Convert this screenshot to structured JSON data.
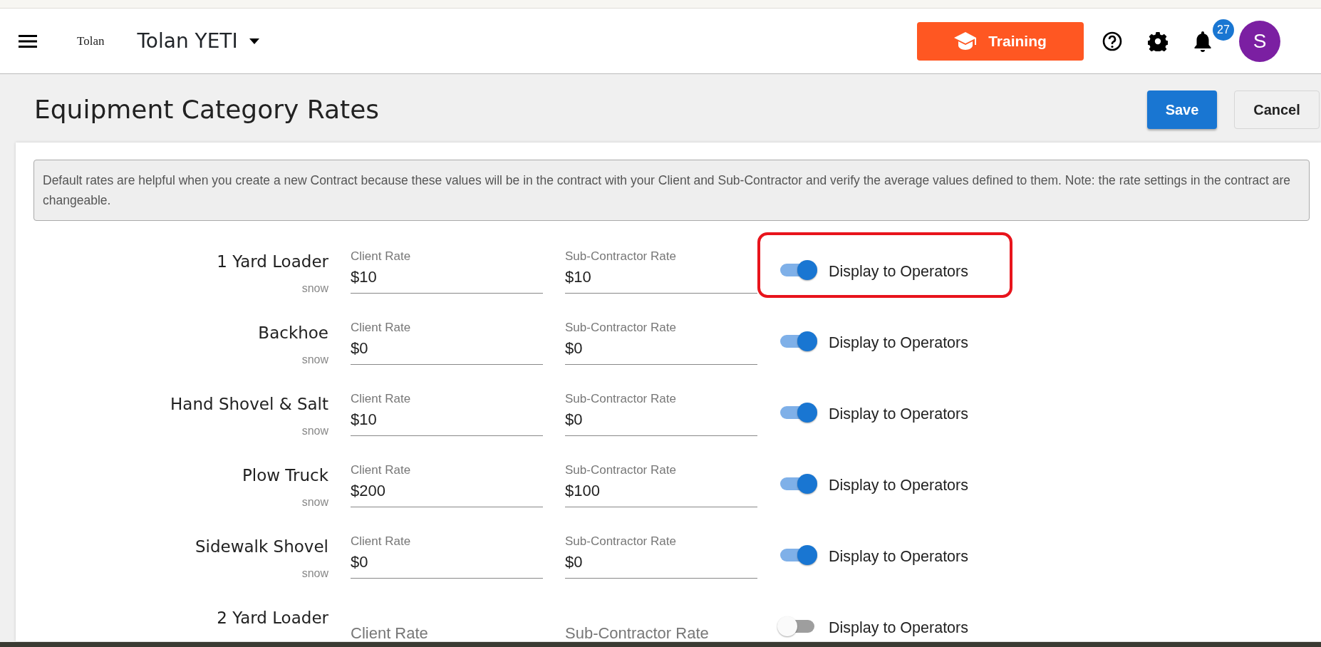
{
  "header": {
    "logo": "Tolan",
    "app_name": "Tolan YETI",
    "training_button": "Training",
    "notifications_count": "27",
    "avatar_letter": "S"
  },
  "page": {
    "title": "Equipment Category Rates",
    "buttons": [
      {
        "kind": "primary",
        "label": "Save"
      },
      {
        "kind": "secondary",
        "label": "Cancel"
      }
    ]
  },
  "info": "Default rates are helpful when you create a new Contract because these values will be in the contract with your Client and Sub-Contractor and verify the average values defined to them. Note: the rate settings in the contract are changeable.",
  "rows": [
    {
      "name": "1 Yard Loader",
      "category": "snow",
      "client_label": "Client Rate",
      "client_value": "$10",
      "sub_label": "Sub-Contractor Rate",
      "sub_value": "$10",
      "display_label": "Display to Operators",
      "on": true,
      "highlighted": true
    },
    {
      "name": "Backhoe",
      "category": "snow",
      "client_label": "Client Rate",
      "client_value": "$0",
      "sub_label": "Sub-Contractor Rate",
      "sub_value": "$0",
      "display_label": "Display to Operators",
      "on": true,
      "highlighted": false
    },
    {
      "name": "Hand Shovel & Salt",
      "category": "snow",
      "client_label": "Client Rate",
      "client_value": "$10",
      "sub_label": "Sub-Contractor Rate",
      "sub_value": "$0",
      "display_label": "Display to Operators",
      "on": true,
      "highlighted": false
    },
    {
      "name": "Plow Truck",
      "category": "snow",
      "client_label": "Client Rate",
      "client_value": "$200",
      "sub_label": "Sub-Contractor Rate",
      "sub_value": "$100",
      "display_label": "Display to Operators",
      "on": true,
      "highlighted": false
    },
    {
      "name": "Sidewalk Shovel",
      "category": "snow",
      "client_label": "Client Rate",
      "client_value": "$0",
      "sub_label": "Sub-Contractor Rate",
      "sub_value": "$0",
      "display_label": "Display to Operators",
      "on": true,
      "highlighted": false
    },
    {
      "name": "2 Yard Loader",
      "client_placeholder": "Client Rate",
      "sub_placeholder": "Sub-Contractor Rate",
      "display_label": "Display to Operators",
      "on": false,
      "highlighted": false
    }
  ]
}
